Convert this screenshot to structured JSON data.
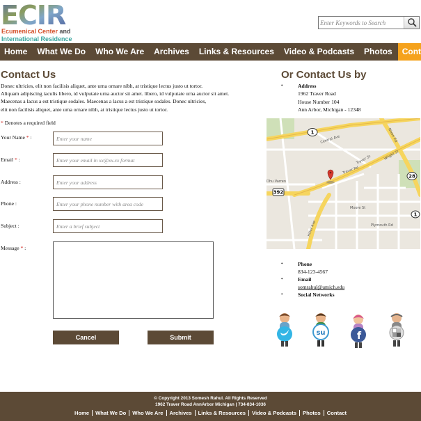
{
  "logo": {
    "mark": "ECIR",
    "line1_a": "Ecumenical Center",
    "line1_and": " and",
    "line2": "International Residence"
  },
  "search": {
    "placeholder": "Enter Keywords to Search",
    "icon": "magnifier-icon"
  },
  "nav": {
    "items": [
      "Home",
      "What We Do",
      "Who We Are",
      "Archives",
      "Links & Resources",
      "Video & Podcasts",
      "Photos",
      "Contact"
    ],
    "active": "Contact",
    "bg_color": "#5c4a36",
    "active_color": "#f5a21c"
  },
  "contact": {
    "heading": "Contact Us",
    "intro": [
      "Donec ultricies, elit non facilisis aliquet, ante urna ornare nibh, at tristique lectus justo ut tortor.",
      "Aliquam adipiscing iaculis libero, id vulputate urna auctor sit amet. libero, id vulputate urna auctor sit amet.",
      "Maecenas a lacus a est tristique sodales. Maecenas a lacus a est tristique sodales. Donec ultricies,",
      "elit non facilisis aliquet, ante urna ornare nibh, at tristique lectus justo ut tortor."
    ],
    "required_star": "*",
    "required_note": " Denotes a required field",
    "fields": {
      "name": {
        "label": "Your Name",
        "required": true,
        "placeholder": "Enter your name"
      },
      "email": {
        "label": "Email",
        "required": true,
        "placeholder": "Enter your email in xx@xx.xx format"
      },
      "address": {
        "label": "Address",
        "required": false,
        "placeholder": "Enter your address"
      },
      "phone": {
        "label": "Phone",
        "required": false,
        "placeholder": "Enter your phone number with area code"
      },
      "subject": {
        "label": "Subject",
        "required": false,
        "placeholder": "Enter a brief subject"
      },
      "message": {
        "label": "Message",
        "required": true
      }
    },
    "cancel_label": "Cancel",
    "submit_label": "Submit"
  },
  "or_contact": {
    "heading": "Or Contact Us by",
    "address_title": "Address",
    "address_lines": [
      "1962 Traver Road",
      "House Number 104",
      "Ann Arbor, Michigan - 12348"
    ],
    "phone_title": "Phone",
    "phone": "834-123-4567",
    "email_title": "Email",
    "email": "somrahul@umich.edu",
    "social_title": "Social Networks"
  },
  "map": {
    "street_labels": [
      "Central Ave",
      "Traver Rd",
      "Traver St",
      "Wright St",
      "Nixon Rd",
      "Moore St",
      "Hiller Ave",
      "Dhu Varren",
      "Plymouth Rd"
    ],
    "route_shields": [
      "1",
      "1",
      "28",
      "392",
      "1"
    ]
  },
  "social": [
    "twitter-icon",
    "stumbleupon-icon",
    "facebook-icon",
    "delicious-icon"
  ],
  "footer": {
    "copyright": "© Copyright 2013 Somesh Rahul. All Rights Reserved",
    "address": "1962 Traver Road AnnArbor Michigan | 734-834-1036",
    "nav": [
      "Home",
      "What We Do",
      "Who We Are",
      "Archives",
      "Links & Resources",
      "Video & Podcasts",
      "Photos",
      "Contact"
    ]
  }
}
